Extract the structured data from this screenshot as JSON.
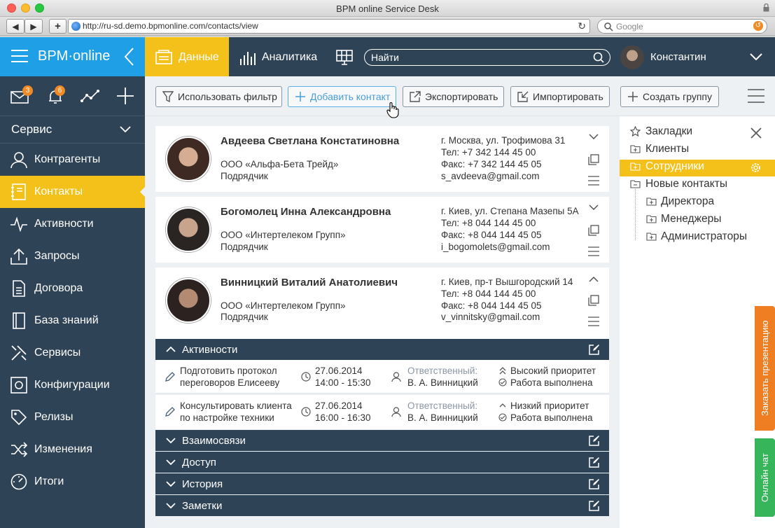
{
  "window": {
    "title": "BPM online Service Desk"
  },
  "browser": {
    "url": "http://ru-sd.demo.bpmonline.com/contacts/view",
    "search_placeholder": "Google"
  },
  "header": {
    "logo": "BPM·online",
    "tab_data": "Данные",
    "tab_analytics": "Аналитика",
    "search_value": "Найти",
    "user": "Константин"
  },
  "topicons": {
    "mail_count": "3",
    "bell_count": "6"
  },
  "sidebar": {
    "workspace": "Сервис",
    "items": [
      {
        "label": "Контрагенты",
        "icon": "person-icon"
      },
      {
        "label": "Контакты",
        "icon": "contact-book-icon"
      },
      {
        "label": "Активности",
        "icon": "pulse-icon"
      },
      {
        "label": "Запросы",
        "icon": "upload-icon"
      },
      {
        "label": "Договора",
        "icon": "document-icon"
      },
      {
        "label": "База знаний",
        "icon": "book-icon"
      },
      {
        "label": "Сервисы",
        "icon": "tools-icon"
      },
      {
        "label": "Конфигурации",
        "icon": "config-icon"
      },
      {
        "label": "Релизы",
        "icon": "tag-icon"
      },
      {
        "label": "Изменения",
        "icon": "shuffle-icon"
      },
      {
        "label": "Итоги",
        "icon": "gauge-icon"
      }
    ]
  },
  "actions": {
    "filter": "Использовать фильтр",
    "add": "Добавить контакт",
    "export": "Экспортировать",
    "import": "Импортировать",
    "group": "Создать группу"
  },
  "contacts": [
    {
      "name": "Авдеева Светлана Констатиновна",
      "company": "ООО «Альфа-Бета Трейд»",
      "role": "Подрядчик",
      "address": "г. Москва, ул. Трофимова 31",
      "phone": "Тел: +7 342 144 45 00",
      "fax": "Факс: +7 342 144 45 05",
      "email": "s_avdeeva@gmail.com"
    },
    {
      "name": "Богомолец Инна Александровна",
      "company": "ООО «Интертелеком Групп»",
      "role": "Подрядчик",
      "address": "г. Киев, ул. Степана Мазепы 5А",
      "phone": "Тел: +8 044 144 45 00",
      "fax": "Факс: +8 044 144 45 05",
      "email": "i_bogomolets@gmail.com"
    },
    {
      "name": "Винницкий Виталий Анатолиевич",
      "company": "ООО «Интертелеком Групп»",
      "role": "Подрядчик",
      "address": "г. Киев, пр-т Вышгородский 14",
      "phone": "Тел: +8 044 144 45 00",
      "fax": "Факс: +8 044 144 45 05",
      "email": "v_vinnitsky@gmail.com"
    }
  ],
  "sections": {
    "activities": "Активности",
    "relations": "Взаимосвязи",
    "access": "Доступ",
    "history": "История",
    "notes": "Заметки"
  },
  "activities": [
    {
      "title1": "Подготовить протокол",
      "title2": "переговоров Елисееву",
      "date": "27.06.2014",
      "time": "14:00 - 15:30",
      "resp_label": "Ответственный:",
      "resp": "В. А. Винницкий",
      "priority": "Высокий приоритет",
      "status": "Работа выполнена"
    },
    {
      "title1": "Консультировать клиента",
      "title2": "по настройке техники",
      "date": "27.06.2014",
      "time": "16:00 - 16:30",
      "resp_label": "Ответственный:",
      "resp": "В. А. Винницкий",
      "priority": "Низкий приоритет",
      "status": "Работа выполнена"
    }
  ],
  "folders": {
    "bookmarks": "Закладки",
    "clients": "Клиенты",
    "employees": "Сотрудники",
    "new_contacts": "Новые контакты",
    "directors": "Директора",
    "managers": "Менеджеры",
    "admins": "Администраторы"
  },
  "side_tabs": {
    "presentation": "Заказать презентацию",
    "chat": "Онлайн чат"
  },
  "colors": {
    "accent": "#f4c01a",
    "nav": "#2f4357",
    "logo_bg": "#1f9fe6",
    "presentation": "#ef7d22",
    "chat": "#37b55b"
  }
}
